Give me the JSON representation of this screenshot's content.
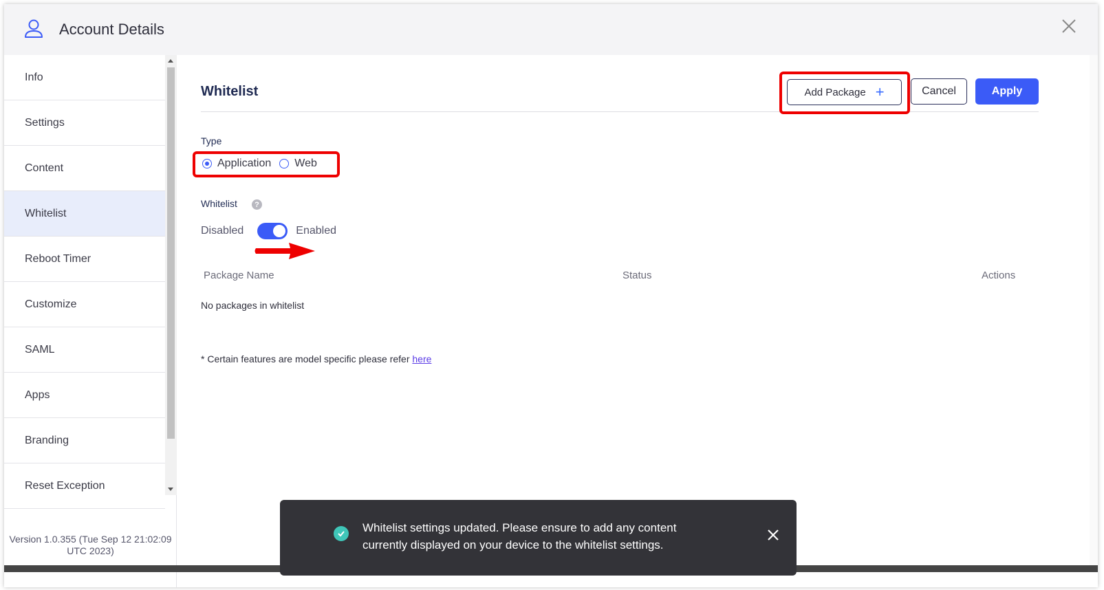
{
  "header": {
    "title": "Account Details"
  },
  "sidebar": {
    "items": [
      {
        "label": "Info"
      },
      {
        "label": "Settings"
      },
      {
        "label": "Content"
      },
      {
        "label": "Whitelist"
      },
      {
        "label": "Reboot Timer"
      },
      {
        "label": "Customize"
      },
      {
        "label": "SAML"
      },
      {
        "label": "Apps"
      },
      {
        "label": "Branding"
      },
      {
        "label": "Reset Exception"
      }
    ],
    "active_index": 3,
    "version": "Version 1.0.355 (Tue Sep 12 21:02:09 UTC 2023)"
  },
  "main": {
    "title": "Whitelist",
    "add_package_label": "Add Package",
    "cancel_label": "Cancel",
    "apply_label": "Apply",
    "type_label": "Type",
    "type_options": [
      {
        "label": "Application",
        "selected": true
      },
      {
        "label": "Web",
        "selected": false
      }
    ],
    "whitelist_label": "Whitelist",
    "toggle_off_label": "Disabled",
    "toggle_on_label": "Enabled",
    "toggle_state": "enabled",
    "table_headers": [
      "Package Name",
      "Status",
      "Actions"
    ],
    "empty_text": "No packages in whitelist",
    "note_text": "* Certain features are model specific please refer ",
    "note_link": "here"
  },
  "toast": {
    "message_line1": "Whitelist settings updated. Please ensure to add any content",
    "message_line2": "currently displayed on your device to the whitelist settings."
  },
  "colors": {
    "accent": "#3b5bf7",
    "highlight": "#ee0000",
    "toast_bg": "#333338",
    "success": "#3fc6b8",
    "active_nav_bg": "#e8edfb"
  }
}
